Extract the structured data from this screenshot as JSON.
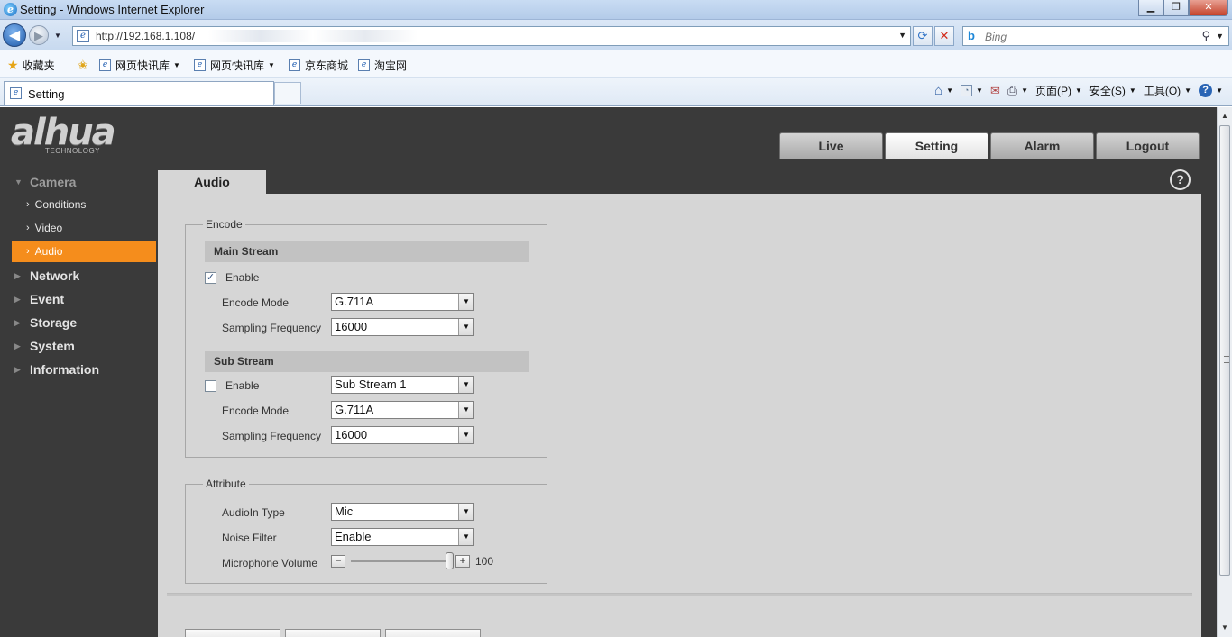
{
  "window": {
    "title": "Setting - Windows Internet Explorer"
  },
  "address": {
    "url": "http://192.168.1.108/"
  },
  "search": {
    "placeholder": "Bing"
  },
  "favorites": {
    "label": "收藏夹",
    "items": [
      "网页快讯库",
      "网页快讯库",
      "京东商城",
      "淘宝网"
    ]
  },
  "tab": {
    "label": "Setting"
  },
  "commands": {
    "page": "页面(P)",
    "safety": "安全(S)",
    "tools": "工具(O)"
  },
  "app": {
    "logo": {
      "brand": "alhua",
      "sub": "TECHNOLOGY"
    },
    "nav": [
      {
        "label": "Live"
      },
      {
        "label": "Setting",
        "active": true
      },
      {
        "label": "Alarm"
      },
      {
        "label": "Logout"
      }
    ],
    "sidebar": {
      "camera": "Camera",
      "sub": [
        "Conditions",
        "Video",
        "Audio"
      ],
      "groups": [
        "Network",
        "Event",
        "Storage",
        "System",
        "Information"
      ]
    },
    "page_tab": "Audio",
    "help": "?",
    "encode": {
      "legend": "Encode",
      "main": {
        "title": "Main Stream",
        "enable_label": "Enable",
        "enabled": true,
        "mode_label": "Encode Mode",
        "mode_value": "G.711A",
        "freq_label": "Sampling Frequency",
        "freq_value": "16000"
      },
      "sub": {
        "title": "Sub Stream",
        "enable_label": "Enable",
        "enabled": false,
        "stream_value": "Sub Stream 1",
        "mode_label": "Encode Mode",
        "mode_value": "G.711A",
        "freq_label": "Sampling Frequency",
        "freq_value": "16000"
      }
    },
    "attribute": {
      "legend": "Attribute",
      "audioin_label": "AudioIn Type",
      "audioin_value": "Mic",
      "noise_label": "Noise Filter",
      "noise_value": "Enable",
      "volume_label": "Microphone Volume",
      "volume_value": "100",
      "volume_fraction": 1.0
    },
    "colors": {
      "accent": "#f58d1c",
      "background": "#3a3a3a",
      "panel": "#d6d6d6"
    }
  }
}
